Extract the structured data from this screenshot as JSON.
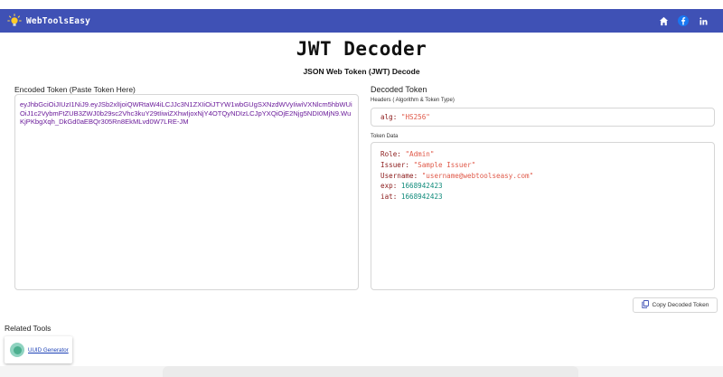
{
  "header": {
    "brand": "WebToolsEasy",
    "icons": [
      "home-icon",
      "facebook-icon",
      "linkedin-icon"
    ],
    "bar_color": "#3f51b5"
  },
  "page": {
    "title": "JWT Decoder",
    "subtitle": "JSON Web Token (JWT) Decode"
  },
  "encoded": {
    "label": "Encoded Token (Paste Token Here)",
    "value": "eyJhbGciOiJIUzI1NiJ9.eyJSb2xlIjoiQWRtaW4iLCJJc3N1ZXIiOiJTYW1wbGUgSXNzdWVyIiwiVXNlcm5hbWUiOiJ1c2VybmFtZUB3ZWJ0b29sc2Vhc3kuY29tIiwiZXhwIjoxNjY4OTQyNDIzLCJpYXQiOjE2Njg5NDI0MjN9.WuKjPKbgXqh_DkGd0aEBQr305Rn8EkMLvd0W7LRE-JM"
  },
  "decoded": {
    "label": "Decoded Token",
    "headers_label": "Headers ( Algorithm & Token Type)",
    "header_key": "alg:",
    "header_value": "\"HS256\"",
    "token_data_label": "Token Data",
    "rows": [
      {
        "key": "Role:",
        "value": "\"Admin\"",
        "type": "string"
      },
      {
        "key": "Issuer:",
        "value": "\"Sample Issuer\"",
        "type": "string"
      },
      {
        "key": "Username:",
        "value": "\"username@webtoolseasy.com\"",
        "type": "string"
      },
      {
        "key": "exp:",
        "value": "1668942423",
        "type": "number"
      },
      {
        "key": "iat:",
        "value": "1668942423",
        "type": "number"
      }
    ],
    "copy_label": "Copy Decoded Token"
  },
  "related": {
    "title": "Related Tools",
    "items": [
      {
        "label": "UUID Generator"
      }
    ]
  }
}
